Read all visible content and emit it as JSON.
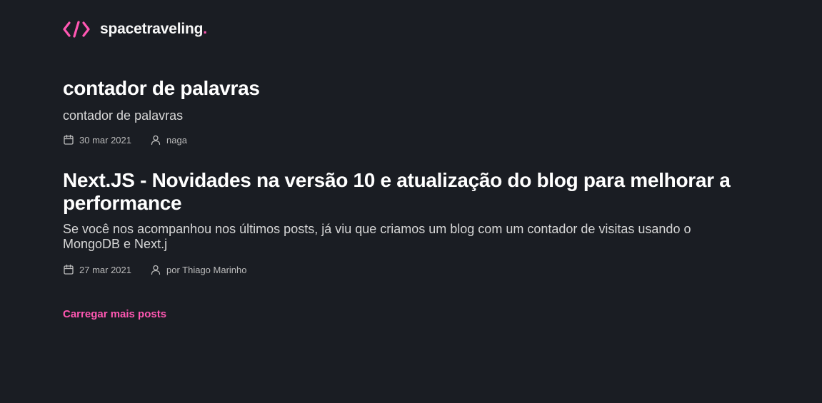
{
  "header": {
    "logo_icon": "code-brackets-icon",
    "site_name": "spacetraveling",
    "site_dot": "."
  },
  "posts": [
    {
      "title": "contador de palavras",
      "subtitle": "contador de palavras",
      "date": "30 mar 2021",
      "author": "naga"
    },
    {
      "title": "Next.JS - Novidades na versão 10 e atualização do blog para melhorar a performance",
      "subtitle": "Se você nos acompanhou nos últimos posts, já viu que criamos um blog com um contador de visitas usando o MongoDB e Next.j",
      "date": "27 mar 2021",
      "author": "por Thiago Marinho"
    }
  ],
  "load_more_label": "Carregar mais posts",
  "colors": {
    "background": "#1a1d23",
    "accent": "#ff57b2",
    "title": "#ffffff",
    "body": "#d7d7d7",
    "meta": "#bbbbbb"
  },
  "icons": {
    "date": "calendar-icon",
    "author": "user-icon"
  }
}
